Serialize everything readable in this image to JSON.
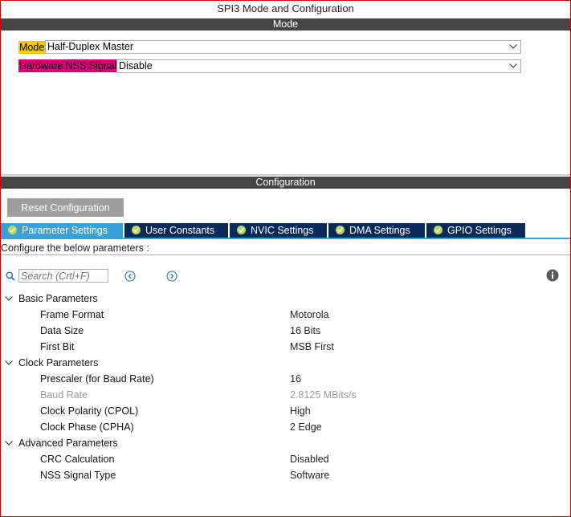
{
  "window": {
    "title": "SPI3 Mode and Configuration"
  },
  "mode_section": {
    "header": "Mode",
    "mode_label": "Mode",
    "mode_value": "Half-Duplex Master",
    "nss_label": "Hardware NSS Signal",
    "nss_value": "Disable"
  },
  "config_section": {
    "header": "Configuration",
    "reset_button": "Reset Configuration",
    "tabs": [
      {
        "label": "Parameter Settings",
        "active": true
      },
      {
        "label": "User Constants",
        "active": false
      },
      {
        "label": "NVIC Settings",
        "active": false
      },
      {
        "label": "DMA Settings",
        "active": false
      },
      {
        "label": "GPIO Settings",
        "active": false
      }
    ],
    "instruction": "Configure the below parameters :",
    "search_placeholder": "Search (Crtl+F)"
  },
  "parameters": {
    "basic": {
      "label": "Basic Parameters",
      "rows": [
        {
          "name": "Frame Format",
          "value": "Motorola"
        },
        {
          "name": "Data Size",
          "value": "16 Bits"
        },
        {
          "name": "First Bit",
          "value": "MSB First"
        }
      ]
    },
    "clock": {
      "label": "Clock Parameters",
      "rows": [
        {
          "name": "Prescaler (for Baud Rate)",
          "value": "16"
        },
        {
          "name": "Baud Rate",
          "value": "2.8125 MBits/s",
          "disabled": true
        },
        {
          "name": "Clock Polarity (CPOL)",
          "value": "High"
        },
        {
          "name": "Clock Phase (CPHA)",
          "value": "2 Edge"
        }
      ]
    },
    "advanced": {
      "label": "Advanced Parameters",
      "rows": [
        {
          "name": "CRC Calculation",
          "value": "Disabled"
        },
        {
          "name": "NSS Signal Type",
          "value": "Software"
        }
      ]
    }
  },
  "colors": {
    "section_bar": "#454545",
    "tab_active": "#3aa0d8",
    "tab_inactive": "#0b2a5c",
    "mode_highlight": "#f6c800",
    "nss_highlight": "#d8007a",
    "check_green": "#b9d85a"
  },
  "icons": {
    "dropdown": "chevron-down-icon",
    "tab_status": "check-circle-icon",
    "search": "search-icon",
    "prev": "arrow-left-circle-icon",
    "next": "arrow-right-circle-icon",
    "info": "info-icon",
    "expand": "chevron-down-icon"
  }
}
